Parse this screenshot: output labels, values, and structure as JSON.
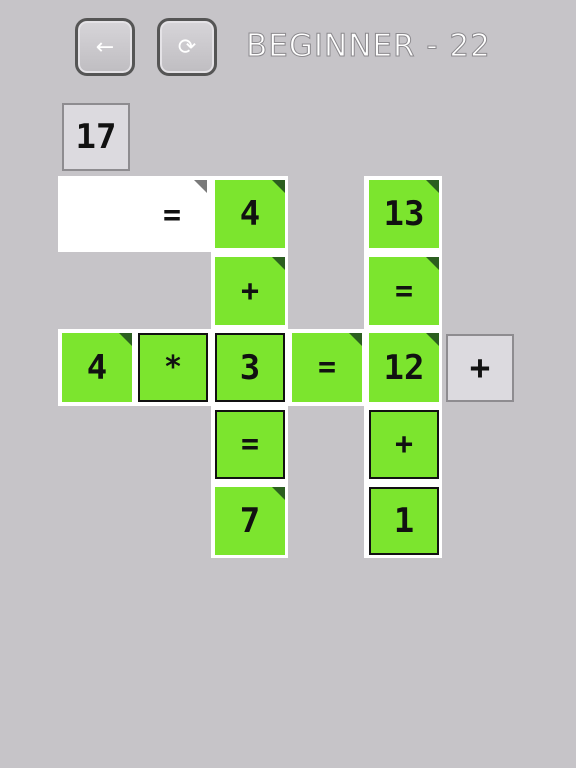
{
  "header": {
    "back_icon": "←",
    "refresh_icon": "⟳",
    "title": "BEGINNER - 22"
  },
  "bank": {
    "top_tile": "17",
    "side_tile": "+"
  },
  "board": {
    "row1": {
      "eq": "=",
      "c3": "4",
      "c5": "13"
    },
    "row2": {
      "c3": "+",
      "c5": "="
    },
    "row3": {
      "c1": "4",
      "c2": "*",
      "c3": "3",
      "c4": "=",
      "c5": "12"
    },
    "row4": {
      "c3": "=",
      "c5": "+"
    },
    "row5": {
      "c3": "7",
      "c5": "1"
    }
  },
  "colors": {
    "background": "#c6c4c8",
    "tile_green": "#7ce52e",
    "corner_dark": "#2b5f1f"
  }
}
